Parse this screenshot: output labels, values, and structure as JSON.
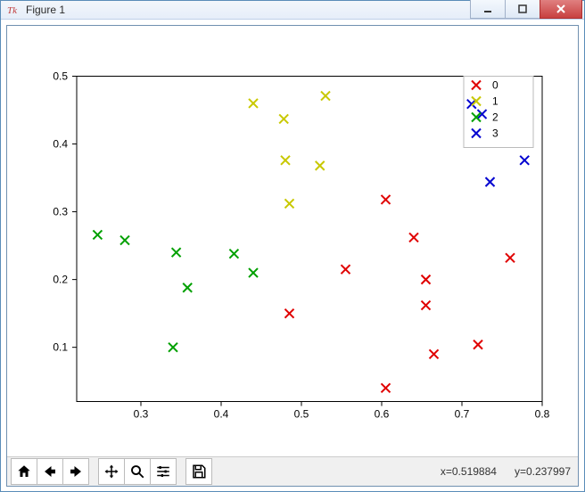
{
  "window": {
    "title": "Figure 1"
  },
  "status": {
    "x_label": "x=0.519884",
    "y_label": "y=0.237997"
  },
  "chart_data": {
    "type": "scatter",
    "xlabel": "",
    "ylabel": "",
    "xlim": [
      0.22,
      0.8
    ],
    "ylim": [
      0.02,
      0.5
    ],
    "xticks": [
      0.3,
      0.4,
      0.5,
      0.6,
      0.7,
      0.8
    ],
    "yticks": [
      0.1,
      0.2,
      0.3,
      0.4,
      0.5
    ],
    "legend": {
      "position": "upper right",
      "entries": [
        "0",
        "1",
        "2",
        "3"
      ]
    },
    "series": [
      {
        "name": "0",
        "color": "#e00000",
        "points": [
          {
            "x": 0.485,
            "y": 0.15
          },
          {
            "x": 0.555,
            "y": 0.215
          },
          {
            "x": 0.605,
            "y": 0.318
          },
          {
            "x": 0.605,
            "y": 0.04
          },
          {
            "x": 0.64,
            "y": 0.262
          },
          {
            "x": 0.655,
            "y": 0.2
          },
          {
            "x": 0.655,
            "y": 0.162
          },
          {
            "x": 0.665,
            "y": 0.09
          },
          {
            "x": 0.72,
            "y": 0.104
          },
          {
            "x": 0.76,
            "y": 0.232
          }
        ]
      },
      {
        "name": "1",
        "color": "#c8c800",
        "points": [
          {
            "x": 0.44,
            "y": 0.46
          },
          {
            "x": 0.478,
            "y": 0.437
          },
          {
            "x": 0.48,
            "y": 0.376
          },
          {
            "x": 0.485,
            "y": 0.312
          },
          {
            "x": 0.523,
            "y": 0.368
          },
          {
            "x": 0.53,
            "y": 0.471
          }
        ]
      },
      {
        "name": "2",
        "color": "#00a000",
        "points": [
          {
            "x": 0.246,
            "y": 0.266
          },
          {
            "x": 0.28,
            "y": 0.258
          },
          {
            "x": 0.344,
            "y": 0.24
          },
          {
            "x": 0.34,
            "y": 0.1
          },
          {
            "x": 0.358,
            "y": 0.188
          },
          {
            "x": 0.416,
            "y": 0.238
          },
          {
            "x": 0.44,
            "y": 0.21
          }
        ]
      },
      {
        "name": "3",
        "color": "#0000d0",
        "points": [
          {
            "x": 0.712,
            "y": 0.459
          },
          {
            "x": 0.725,
            "y": 0.444
          },
          {
            "x": 0.735,
            "y": 0.344
          },
          {
            "x": 0.778,
            "y": 0.376
          }
        ]
      }
    ]
  },
  "toolbar": {
    "home": "Home",
    "back": "Back",
    "forward": "Forward",
    "pan": "Pan",
    "zoom": "Zoom",
    "configure": "Configure subplots",
    "save": "Save"
  }
}
